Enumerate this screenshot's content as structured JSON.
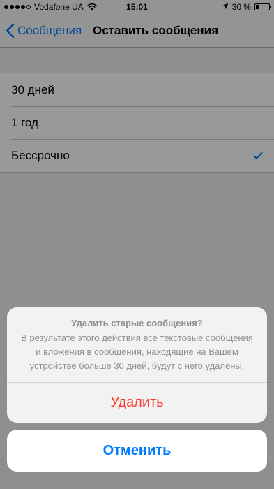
{
  "status_bar": {
    "carrier": "Vodafone UA",
    "time": "15:01",
    "battery_percent": "30 %",
    "battery_level": 0.3,
    "signal_bars_filled": 4,
    "signal_bars_total": 5
  },
  "nav": {
    "back_label": "Сообщения",
    "title": "Оставить сообщения"
  },
  "options": [
    {
      "label": "30 дней",
      "selected": false
    },
    {
      "label": "1 год",
      "selected": false
    },
    {
      "label": "Бессрочно",
      "selected": true
    }
  ],
  "action_sheet": {
    "title": "Удалить старые сообщения?",
    "message": "В результате этого действия все текстовые сообщения и вложения в сообщения, находящие на Вашем устройстве больше 30 дней, будут с него удалены.",
    "delete_label": "Удалить",
    "cancel_label": "Отменить"
  },
  "colors": {
    "accent": "#007aff",
    "destructive": "#ff3b30"
  },
  "icons": {
    "back": "chevron-left-icon",
    "selected": "checkmark-icon",
    "location": "location-arrow-icon",
    "wifi": "wifi-icon"
  }
}
